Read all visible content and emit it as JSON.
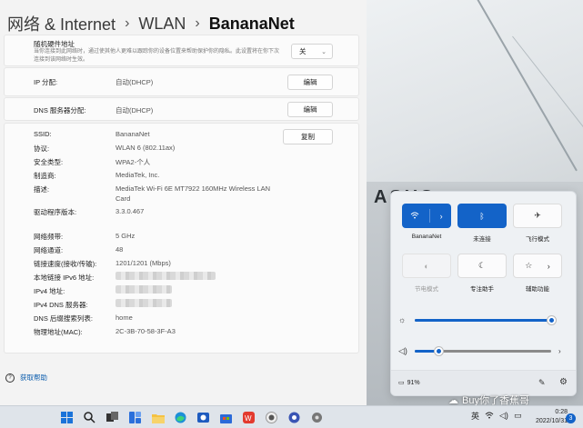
{
  "breadcrumb": {
    "part1": "网络 & Internet",
    "part2": "WLAN",
    "current": "BananaNet",
    "separator": "›"
  },
  "random_hw": {
    "label": "随机硬件地址",
    "desc": "当你连接到此网络时，通过使其他人更难以跟踪你的设备位置来帮助保护你的隐私。此设置将在你下次连接到该网络时生效。",
    "value": "关"
  },
  "ip_assign": {
    "label": "IP 分配:",
    "value": "自动(DHCP)",
    "button": "编辑"
  },
  "dns_assign": {
    "label": "DNS 服务器分配:",
    "value": "自动(DHCP)",
    "button": "编辑"
  },
  "copy_button": "复制",
  "properties": [
    {
      "label": "SSID:",
      "value": "BananaNet"
    },
    {
      "label": "协议:",
      "value": "WLAN 6 (802.11ax)"
    },
    {
      "label": "安全类型:",
      "value": "WPA2-个人"
    },
    {
      "label": "制造商:",
      "value": "MediaTek, Inc."
    },
    {
      "label": "描述:",
      "value": "MediaTek Wi-Fi 6E MT7922 160MHz Wireless LAN Card"
    },
    {
      "label": "驱动程序版本:",
      "value": "3.3.0.467"
    },
    {
      "label": "网络频带:",
      "value": "5 GHz"
    },
    {
      "label": "网络通道:",
      "value": "48"
    },
    {
      "label": "链接速度(接收/传输):",
      "value": "1201/1201 (Mbps)"
    },
    {
      "label": "本地链接 IPv6 地址:",
      "value": ""
    },
    {
      "label": "IPv4 地址:",
      "value": ""
    },
    {
      "label": "IPv4 DNS 服务器:",
      "value": ""
    },
    {
      "label": "DNS 后缀搜索列表:",
      "value": "home"
    },
    {
      "label": "物理地址(MAC):",
      "value": "2C-3B-70-58-3F-A3"
    }
  ],
  "help": {
    "label": "获取帮助"
  },
  "wallpaper_text": "ASUS",
  "quick": {
    "tiles": [
      {
        "label": "BananaNet",
        "icon": "wifi-icon",
        "state": "on"
      },
      {
        "label": "未连接",
        "icon": "bluetooth-icon",
        "state": "on"
      },
      {
        "label": "飞行模式",
        "icon": "airplane-icon",
        "state": "off"
      },
      {
        "label": "节电模式",
        "icon": "battery-saver-icon",
        "state": "disabled"
      },
      {
        "label": "专注助手",
        "icon": "moon-icon",
        "state": "off"
      },
      {
        "label": "辅助功能",
        "icon": "accessibility-icon",
        "state": "off"
      }
    ],
    "brightness": 1.0,
    "volume": 0.17,
    "battery": "91%"
  },
  "watermark": "Buy你了香蕉哥",
  "taskbar": {
    "lang": "英",
    "time": "0:28",
    "date": "2022/10/31",
    "notifications": "3"
  },
  "colors": {
    "accent": "#1363c8",
    "link": "#0b5cad"
  }
}
